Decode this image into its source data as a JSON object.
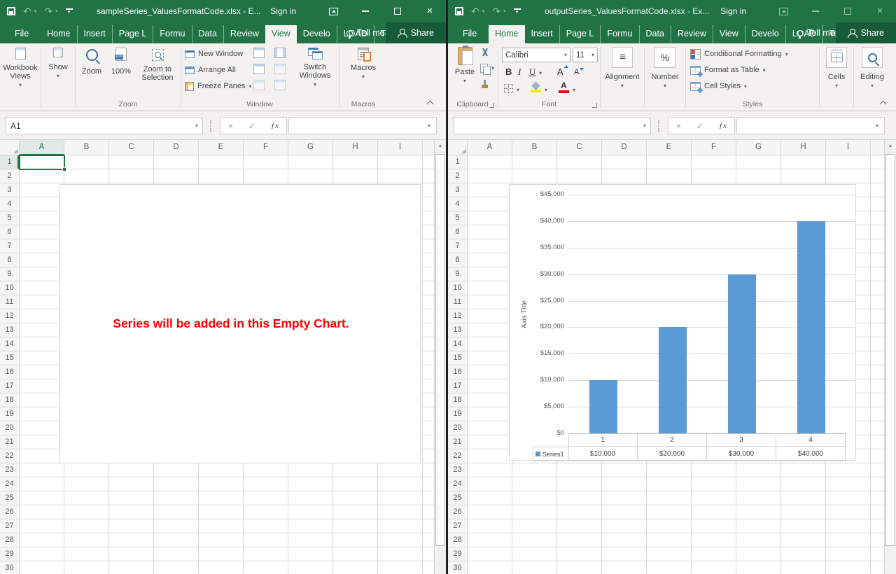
{
  "icons": {
    "undo": "↶",
    "redo": "↷",
    "dropdown": "▾",
    "up_arrow": "▲",
    "corner_triangle": "◢",
    "cancel": "×",
    "check": "✓",
    "fx": "ƒx",
    "close": "×",
    "percent": "%",
    "align_lines": "≡",
    "bold": "B",
    "italic": "I",
    "underline": "U",
    "font_grow": "A",
    "font_shrink": "A",
    "font_color": "A"
  },
  "sheet": {
    "columns": [
      "A",
      "B",
      "C",
      "D",
      "E",
      "F",
      "G",
      "H",
      "I"
    ],
    "rows": [
      "1",
      "2",
      "3",
      "4",
      "5",
      "6",
      "7",
      "8",
      "9",
      "10",
      "11",
      "12",
      "13",
      "14",
      "15",
      "16",
      "17",
      "18",
      "19",
      "20",
      "21",
      "22",
      "23",
      "24",
      "25",
      "26",
      "27",
      "28",
      "29",
      "30"
    ]
  },
  "left_window": {
    "title": "sampleSeries_ValuesFormatCode.xlsx  -  E...",
    "sign_in": "Sign in",
    "tabs": [
      "File",
      "Home",
      "Insert",
      "Page L",
      "Formu",
      "Data",
      "Review",
      "View",
      "Develo",
      "LOAD",
      "Team"
    ],
    "active_tab": "View",
    "tell_me": "Tell me",
    "share": "Share",
    "name_box": "A1",
    "formula": "",
    "ribbon": {
      "workbook_views": "Workbook Views",
      "show": "Show",
      "zoom": "Zoom",
      "zoom_100": "100%",
      "zoom_to_selection": "Zoom to Selection",
      "new_window": "New Window",
      "arrange_all": "Arrange All",
      "freeze_panes": "Freeze Panes",
      "switch_windows": "Switch Windows",
      "macros": "Macros",
      "group_zoom": "Zoom",
      "group_window": "Window",
      "group_macros": "Macros"
    },
    "chart_message": "Series will be added in this Empty Chart."
  },
  "right_window": {
    "title": "outputSeries_ValuesFormatCode.xlsx  -  Ex...",
    "sign_in": "Sign in",
    "tabs": [
      "File",
      "Home",
      "Insert",
      "Page L",
      "Formu",
      "Data",
      "Review",
      "View",
      "Develo",
      "LOAD",
      "Team"
    ],
    "active_tab": "Home",
    "tell_me": "Tell me",
    "share": "Share",
    "name_box": "",
    "formula": "",
    "ribbon": {
      "paste": "Paste",
      "font_name": "Calibri",
      "font_size": "11",
      "alignment": "Alignment",
      "number": "Number",
      "conditional_formatting": "Conditional Formatting",
      "format_as_table": "Format as Table",
      "cell_styles": "Cell Styles",
      "cells": "Cells",
      "editing": "Editing",
      "group_clipboard": "Clipboard",
      "group_font": "Font",
      "group_styles": "Styles"
    }
  },
  "chart_data": {
    "type": "bar",
    "title": "",
    "categories": [
      "1",
      "2",
      "3",
      "4"
    ],
    "series": [
      {
        "name": "Series1",
        "values": [
          10000,
          20000,
          30000,
          40000
        ],
        "value_labels": [
          "$10,000",
          "$20,000",
          "$30,000",
          "$40,000"
        ]
      }
    ],
    "xlabel": "",
    "ylabel": "Axis Title",
    "ylim": [
      0,
      45000
    ],
    "ytick_interval": 5000,
    "ytick_labels": [
      "$0",
      "$5,000",
      "$10,000",
      "$15,000",
      "$20,000",
      "$25,000",
      "$30,000",
      "$35,000",
      "$40,000",
      "$45,000"
    ],
    "bar_color": "#5b9bd5",
    "grid": true,
    "legend": "Series1",
    "legend_position": "data-table",
    "data_table": true
  },
  "colors": {
    "title_bar": "#217346",
    "share_background": "#175b38",
    "selection": "#217346",
    "bar": "#5b9bd5",
    "message_text": "#ff0000",
    "gridline": "#d9d9d9"
  }
}
